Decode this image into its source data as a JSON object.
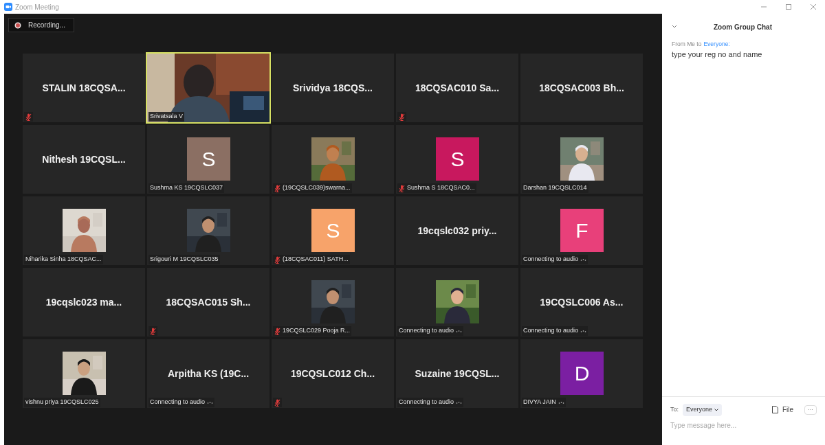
{
  "window": {
    "title": "Zoom Meeting"
  },
  "recording": {
    "label": "Recording..."
  },
  "tiles": [
    {
      "kind": "name",
      "name": "STALIN 18CQSA...",
      "muted": true,
      "connecting": false,
      "selected": false
    },
    {
      "kind": "video",
      "label": "Srivatsala V",
      "muted": false,
      "connecting": false,
      "selected": true
    },
    {
      "kind": "name",
      "name": "Srividya 18CQS...",
      "muted": false,
      "connecting": false,
      "selected": false
    },
    {
      "kind": "name",
      "name": "18CQSAC010 Sa...",
      "muted": true,
      "connecting": false,
      "selected": false
    },
    {
      "kind": "name",
      "name": "18CQSAC003 Bh...",
      "muted": false,
      "connecting": false,
      "selected": false
    },
    {
      "kind": "name",
      "name": "Nithesh 19CQSL...",
      "muted": false,
      "connecting": false,
      "selected": false
    },
    {
      "kind": "initial",
      "initial": "S",
      "color": "#8b6f63",
      "label": "Sushma KS 19CQSLC037",
      "muted": false,
      "connecting": false,
      "selected": false
    },
    {
      "label": "(19CQSLC039)swarna...",
      "muted": true,
      "connecting": false,
      "selected": false
    },
    {
      "kind": "initial",
      "initial": "S",
      "color": "#c8185e",
      "label": "Sushma S 18CQSAC0...",
      "muted": true,
      "connecting": false,
      "selected": false
    },
    {
      "label": "Darshan 19CQSLC014",
      "muted": false,
      "connecting": false,
      "selected": false
    },
    {
      "label": "Niharika Sinha 18CQSAC...",
      "muted": false,
      "connecting": false,
      "selected": false
    },
    {
      "label": "Srigouri M 19CQSLC035",
      "muted": false,
      "connecting": false,
      "selected": false
    },
    {
      "kind": "initial",
      "initial": "S",
      "color": "#f7a36a",
      "label": "(18CQSAC011) SATH...",
      "muted": true,
      "connecting": false,
      "selected": false
    },
    {
      "kind": "name",
      "name": "19cqslc032 priy...",
      "muted": false,
      "connecting": false,
      "selected": false
    },
    {
      "kind": "initial",
      "initial": "F",
      "color": "#e8407a",
      "label": "Connecting to audio",
      "muted": false,
      "connecting": true,
      "selected": false
    },
    {
      "kind": "name",
      "name": "19cqslc023 ma...",
      "muted": false,
      "connecting": false,
      "selected": false
    },
    {
      "kind": "name",
      "name": "18CQSAC015 Sh...",
      "muted": true,
      "connecting": false,
      "selected": false
    },
    {
      "label": "19CQSLC029 Pooja R...",
      "muted": true,
      "connecting": false,
      "selected": false
    },
    {
      "label": "Connecting to audio",
      "muted": false,
      "connecting": true,
      "selected": false
    },
    {
      "kind": "name",
      "name": "19CQSLC006 As...",
      "label": "Connecting to audio",
      "muted": false,
      "connecting": true,
      "selected": false
    },
    {
      "label": "vishnu priya 19CQSLC025",
      "muted": false,
      "connecting": false,
      "selected": false
    },
    {
      "kind": "name",
      "name": "Arpitha KS (19C...",
      "label": "Connecting to audio",
      "muted": false,
      "connecting": true,
      "selected": false
    },
    {
      "kind": "name",
      "name": "19CQSLC012 Ch...",
      "muted": true,
      "connecting": false,
      "selected": false
    },
    {
      "kind": "name",
      "name": "Suzaine 19CQSL...",
      "label": "Connecting to audio",
      "muted": false,
      "connecting": true,
      "selected": false
    },
    {
      "kind": "initial",
      "initial": "D",
      "color": "#7b1fa2",
      "label": "DIVYA JAIN",
      "muted": false,
      "connecting": true,
      "selected": false
    }
  ],
  "chat": {
    "title": "Zoom Group Chat",
    "messages": [
      {
        "from": "From Me to",
        "to": "Everyone:",
        "text": "type your reg no and name"
      }
    ],
    "to_label": "To:",
    "recipient": "Everyone",
    "file_button": "File",
    "more_button": "···",
    "placeholder": "Type message here..."
  }
}
